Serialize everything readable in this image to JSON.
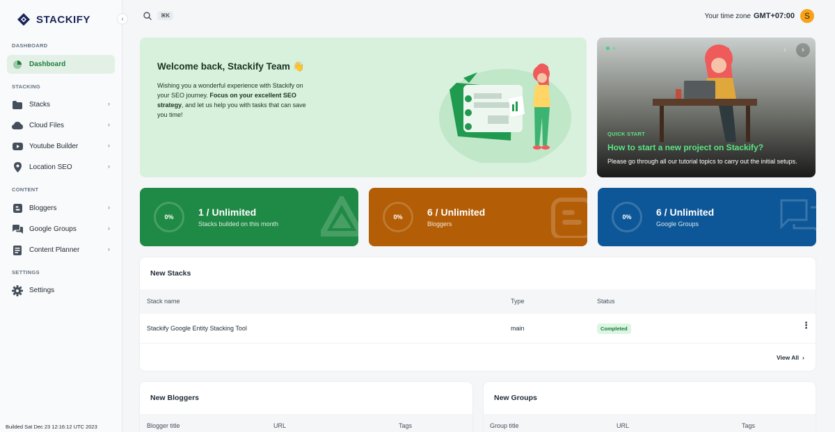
{
  "brand": {
    "name": "STACKIFY"
  },
  "sidebar": {
    "sections": [
      {
        "label": "DASHBOARD"
      },
      {
        "label": "STACKING"
      },
      {
        "label": "CONTENT"
      },
      {
        "label": "SETTINGS"
      }
    ],
    "items": [
      {
        "label": "Dashboard",
        "icon": "dashboard-icon"
      },
      {
        "label": "Stacks",
        "icon": "folder-icon"
      },
      {
        "label": "Cloud Files",
        "icon": "cloud-icon"
      },
      {
        "label": "Youtube Builder",
        "icon": "youtube-icon"
      },
      {
        "label": "Location SEO",
        "icon": "location-pin-icon"
      },
      {
        "label": "Bloggers",
        "icon": "blogger-icon"
      },
      {
        "label": "Google Groups",
        "icon": "groups-icon"
      },
      {
        "label": "Content Planner",
        "icon": "planner-icon"
      },
      {
        "label": "Settings",
        "icon": "gear-icon"
      }
    ],
    "build_info": "Builded Sat Dec 23 12:16:12 UTC 2023"
  },
  "topbar": {
    "shortcut": "⌘K",
    "timezone_label": "Your time zone",
    "timezone_value": "GMT+07:00",
    "avatar_letter": "S"
  },
  "welcome": {
    "title": "Welcome back, Stackify Team 👋",
    "text_1": "Wishing you a wonderful experience with Stackify on your SEO journey. ",
    "text_bold": "Focus on your excellent SEO strategy",
    "text_2": ", and let us help you with tasks that can save you time!"
  },
  "quick_start": {
    "tag": "QUICK START",
    "title": "How to start a new project on Stackify?",
    "description": "Please go through all our tutorial topics to carry out the initial setups."
  },
  "stats": [
    {
      "percent": "0%",
      "value": "1 / Unlimited",
      "label": "Stacks builded on this month",
      "color": "#1f8a45"
    },
    {
      "percent": "0%",
      "value": "6 / Unlimited",
      "label": "Bloggers",
      "color": "#b35d06"
    },
    {
      "percent": "0%",
      "value": "6 / Unlimited",
      "label": "Google Groups",
      "color": "#0d5798"
    }
  ],
  "new_stacks": {
    "title": "New Stacks",
    "columns": [
      "Stack name",
      "Type",
      "Status"
    ],
    "rows": [
      {
        "name": "Stackify Google Entity Stacking Tool",
        "type": "main",
        "status": "Completed"
      }
    ],
    "view_all": "View All"
  },
  "new_bloggers": {
    "title": "New Bloggers",
    "columns": [
      "Blogger title",
      "URL",
      "Tags"
    ]
  },
  "new_groups": {
    "title": "New Groups",
    "columns": [
      "Group title",
      "URL",
      "Tags"
    ]
  }
}
